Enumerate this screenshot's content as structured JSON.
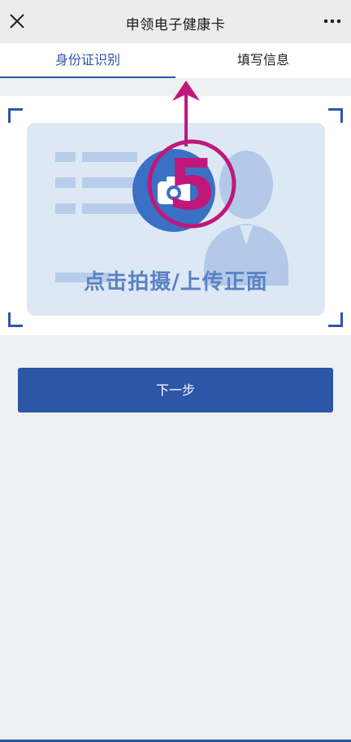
{
  "header": {
    "title": "申领电子健康卡",
    "close_icon": "close-icon",
    "more_icon": "more-icon"
  },
  "tabs": [
    {
      "label": "身份证识别",
      "active": true
    },
    {
      "label": "填写信息",
      "active": false
    }
  ],
  "upload": {
    "label": "点击拍摄/上传正面",
    "icon": "camera-icon"
  },
  "next_button": {
    "label": "下一步"
  },
  "annotation": {
    "step_number": "5",
    "color": "#c0187a"
  },
  "colors": {
    "accent": "#2d57a8",
    "background": "#eff0f1",
    "card": "#dde8f5"
  }
}
